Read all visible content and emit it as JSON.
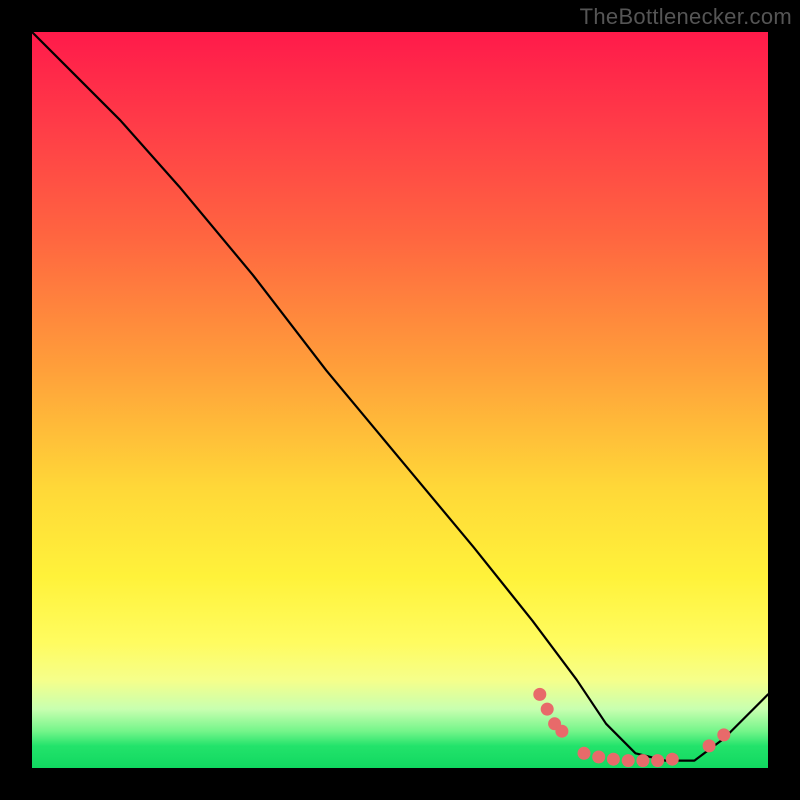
{
  "attribution": "TheBottlenecker.com",
  "chart_data": {
    "type": "line",
    "title": "",
    "xlabel": "",
    "ylabel": "",
    "xlim": [
      0,
      100
    ],
    "ylim": [
      0,
      100
    ],
    "series": [
      {
        "name": "curve",
        "x": [
          0,
          6,
          12,
          20,
          30,
          40,
          50,
          60,
          68,
          74,
          78,
          82,
          86,
          90,
          94,
          100
        ],
        "values": [
          100,
          94,
          88,
          79,
          67,
          54,
          42,
          30,
          20,
          12,
          6,
          2,
          1,
          1,
          4,
          10
        ]
      }
    ],
    "markers": {
      "name": "highlight-dots",
      "color": "#e86a6a",
      "points": [
        {
          "x": 69,
          "y": 10
        },
        {
          "x": 70,
          "y": 8
        },
        {
          "x": 71,
          "y": 6
        },
        {
          "x": 72,
          "y": 5
        },
        {
          "x": 75,
          "y": 2
        },
        {
          "x": 77,
          "y": 1.5
        },
        {
          "x": 79,
          "y": 1.2
        },
        {
          "x": 81,
          "y": 1
        },
        {
          "x": 83,
          "y": 1
        },
        {
          "x": 85,
          "y": 1
        },
        {
          "x": 87,
          "y": 1.2
        },
        {
          "x": 92,
          "y": 3
        },
        {
          "x": 94,
          "y": 4.5
        }
      ]
    },
    "gradient_stops": [
      {
        "pos": 0.0,
        "color": "#ff1a4a"
      },
      {
        "pos": 0.12,
        "color": "#ff3a48"
      },
      {
        "pos": 0.28,
        "color": "#ff6640"
      },
      {
        "pos": 0.46,
        "color": "#ffa03a"
      },
      {
        "pos": 0.62,
        "color": "#ffd838"
      },
      {
        "pos": 0.74,
        "color": "#fff23a"
      },
      {
        "pos": 0.83,
        "color": "#fffc60"
      },
      {
        "pos": 0.88,
        "color": "#f6ff8a"
      },
      {
        "pos": 0.92,
        "color": "#c8ffb0"
      },
      {
        "pos": 0.95,
        "color": "#74f58a"
      },
      {
        "pos": 0.97,
        "color": "#23e36b"
      },
      {
        "pos": 1.0,
        "color": "#10d860"
      }
    ]
  }
}
